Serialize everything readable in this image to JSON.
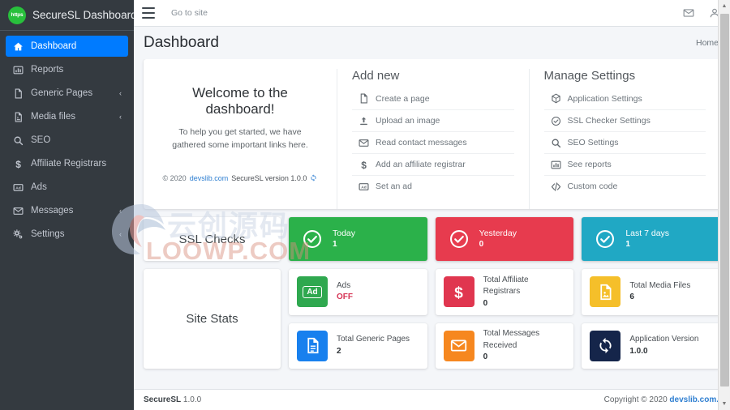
{
  "brand": {
    "logo_text": "https",
    "title": "SecureSL Dashboard",
    "logo_color": "#28c03c"
  },
  "sidebar": {
    "items": [
      {
        "label": "Dashboard",
        "icon": "home-icon",
        "active": true,
        "caret": false
      },
      {
        "label": "Reports",
        "icon": "chart-bar-icon",
        "active": false,
        "caret": false
      },
      {
        "label": "Generic Pages",
        "icon": "file-icon",
        "active": false,
        "caret": true
      },
      {
        "label": "Media files",
        "icon": "file-image-icon",
        "active": false,
        "caret": true
      },
      {
        "label": "SEO",
        "icon": "search-icon",
        "active": false,
        "caret": false
      },
      {
        "label": "Affiliate Registrars",
        "icon": "dollar-icon",
        "active": false,
        "caret": false
      },
      {
        "label": "Ads",
        "icon": "ad-icon",
        "active": false,
        "caret": false
      },
      {
        "label": "Messages",
        "icon": "envelope-icon",
        "active": false,
        "caret": true
      },
      {
        "label": "Settings",
        "icon": "cogs-icon",
        "active": false,
        "caret": true
      }
    ],
    "caret_glyph": "‹",
    "active_color": "#007bff"
  },
  "topbar": {
    "menu_toggle": "hamburger-icon",
    "go_to_site": "Go to site",
    "messages_icon": "envelope-icon",
    "user_icon": "user-icon"
  },
  "page": {
    "title": "Dashboard",
    "breadcrumb": "Home"
  },
  "welcome": {
    "heading": "Welcome to the dashboard!",
    "text": "To help you get started, we have gathered some important links here.",
    "copyright": "© 2020",
    "site_link": "devslib.com",
    "version_text": "SecureSL version 1.0.0",
    "sync_icon": "sync-icon"
  },
  "add_new": {
    "title": "Add new",
    "items": [
      {
        "label": "Create a page",
        "icon": "file-icon"
      },
      {
        "label": "Upload an image",
        "icon": "upload-icon"
      },
      {
        "label": "Read contact messages",
        "icon": "envelope-icon"
      },
      {
        "label": "Add an affiliate registrar",
        "icon": "dollar-icon"
      },
      {
        "label": "Set an ad",
        "icon": "ad-icon"
      }
    ]
  },
  "manage_settings": {
    "title": "Manage Settings",
    "items": [
      {
        "label": "Application Settings",
        "icon": "cube-icon"
      },
      {
        "label": "SSL Checker Settings",
        "icon": "check-circle-icon"
      },
      {
        "label": "SEO Settings",
        "icon": "search-icon"
      },
      {
        "label": "See reports",
        "icon": "chart-bar-icon"
      },
      {
        "label": "Custom code",
        "icon": "code-icon"
      }
    ]
  },
  "ssl_checks": {
    "label": "SSL Checks",
    "boxes": [
      {
        "title": "Today",
        "value": "1",
        "color": "#2bb14a",
        "icon": "check-circle-icon"
      },
      {
        "title": "Yesterday",
        "value": "0",
        "color": "#e73b4e",
        "icon": "check-circle-icon"
      },
      {
        "title": "Last 7 days",
        "value": "1",
        "color": "#20a8c4",
        "icon": "check-circle-icon"
      }
    ]
  },
  "site_stats": {
    "label": "Site Stats",
    "cards": [
      {
        "label": "Ads",
        "value": "OFF",
        "value_style": "off",
        "color": "#2fa84f",
        "icon": "ad-icon"
      },
      {
        "label": "Total Affiliate Registrars",
        "value": "0",
        "value_style": "",
        "color": "#e0364f",
        "icon": "dollar-icon"
      },
      {
        "label": "Total Media Files",
        "value": "6",
        "value_style": "",
        "color": "#f5bf2a",
        "icon": "file-image-icon"
      },
      {
        "label": "Total Generic Pages",
        "value": "2",
        "value_style": "",
        "color": "#1880ee",
        "icon": "file-lines-icon"
      },
      {
        "label": "Total Messages Received",
        "value": "0",
        "value_style": "",
        "color": "#f6871f",
        "icon": "envelope-icon"
      },
      {
        "label": "Application Version",
        "value": "1.0.0",
        "value_style": "",
        "color": "#15254a",
        "icon": "sync-icon"
      }
    ]
  },
  "footer": {
    "app_name": "SecureSL",
    "app_version": "1.0.0",
    "copyright": "Copyright © 2020",
    "link": "devslib.com."
  },
  "watermark": {
    "cn_text": "云创源码",
    "en_text": "LOOWP.COM"
  }
}
